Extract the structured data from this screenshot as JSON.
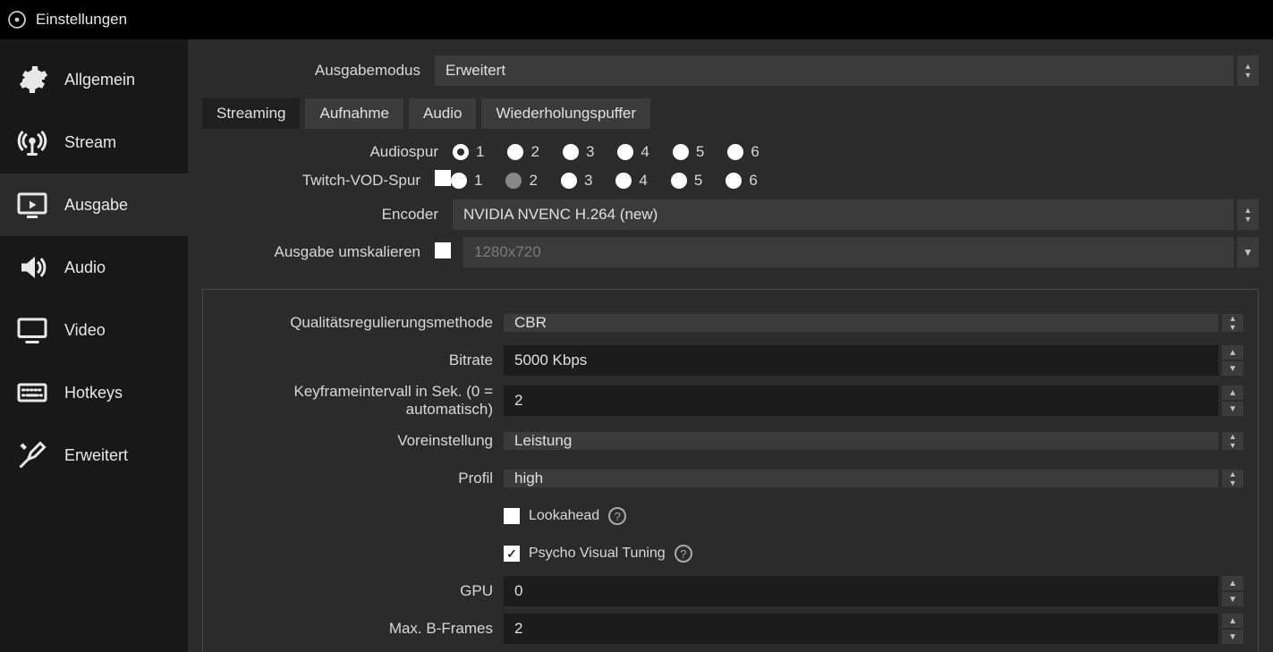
{
  "window": {
    "title": "Einstellungen"
  },
  "sidebar": {
    "items": [
      {
        "label": "Allgemein"
      },
      {
        "label": "Stream"
      },
      {
        "label": "Ausgabe"
      },
      {
        "label": "Audio"
      },
      {
        "label": "Video"
      },
      {
        "label": "Hotkeys"
      },
      {
        "label": "Erweitert"
      }
    ],
    "active_index": 2
  },
  "output_mode": {
    "label": "Ausgabemodus",
    "value": "Erweitert"
  },
  "tabs": {
    "items": [
      {
        "label": "Streaming"
      },
      {
        "label": "Aufnahme"
      },
      {
        "label": "Audio"
      },
      {
        "label": "Wiederholungspuffer"
      }
    ],
    "active_index": 0
  },
  "audiotrack": {
    "label": "Audiospur",
    "options": [
      "1",
      "2",
      "3",
      "4",
      "5",
      "6"
    ],
    "selected": "1"
  },
  "twitchvod": {
    "label": "Twitch-VOD-Spur",
    "enabled": false,
    "options": [
      "1",
      "2",
      "3",
      "4",
      "5",
      "6"
    ],
    "selected": "2"
  },
  "encoder": {
    "label": "Encoder",
    "value": "NVIDIA NVENC H.264 (new)"
  },
  "rescale": {
    "label": "Ausgabe umskalieren",
    "enabled": false,
    "value": "1280x720"
  },
  "encoder_settings": {
    "rate_control": {
      "label": "Qualitätsregulierungsmethode",
      "value": "CBR"
    },
    "bitrate": {
      "label": "Bitrate",
      "value": "5000 Kbps"
    },
    "keyframe": {
      "label": "Keyframeintervall in Sek. (0 = automatisch)",
      "value": "2"
    },
    "preset": {
      "label": "Voreinstellung",
      "value": "Leistung"
    },
    "profile": {
      "label": "Profil",
      "value": "high"
    },
    "lookahead": {
      "label": "Lookahead",
      "checked": false
    },
    "psycho": {
      "label": "Psycho Visual Tuning",
      "checked": true
    },
    "gpu": {
      "label": "GPU",
      "value": "0"
    },
    "bframes": {
      "label": "Max. B-Frames",
      "value": "2"
    }
  }
}
